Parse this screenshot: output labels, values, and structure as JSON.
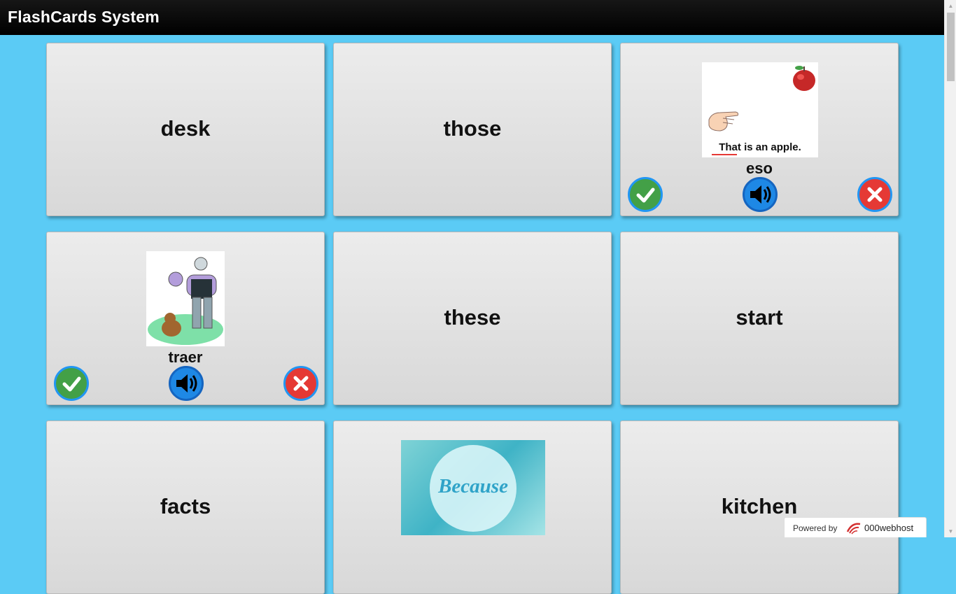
{
  "app": {
    "title": "FlashCards System"
  },
  "cards": [
    {
      "word": "desk"
    },
    {
      "word": "those"
    },
    {
      "caption": "eso",
      "image_text": "That is an apple."
    },
    {
      "caption": "traer"
    },
    {
      "word": "these"
    },
    {
      "word": "start"
    },
    {
      "word": "facts"
    },
    {
      "image_text": "Because"
    },
    {
      "word": "kitchen"
    }
  ],
  "icons": {
    "correct": "check-icon",
    "wrong": "close-icon",
    "audio": "speaker-icon"
  },
  "colors": {
    "background": "#5bcbf5",
    "correct": "#43a047",
    "wrong": "#e53935",
    "audio": "#1e88e5"
  },
  "footer": {
    "powered_by": "Powered by",
    "brand": "000webhost"
  }
}
